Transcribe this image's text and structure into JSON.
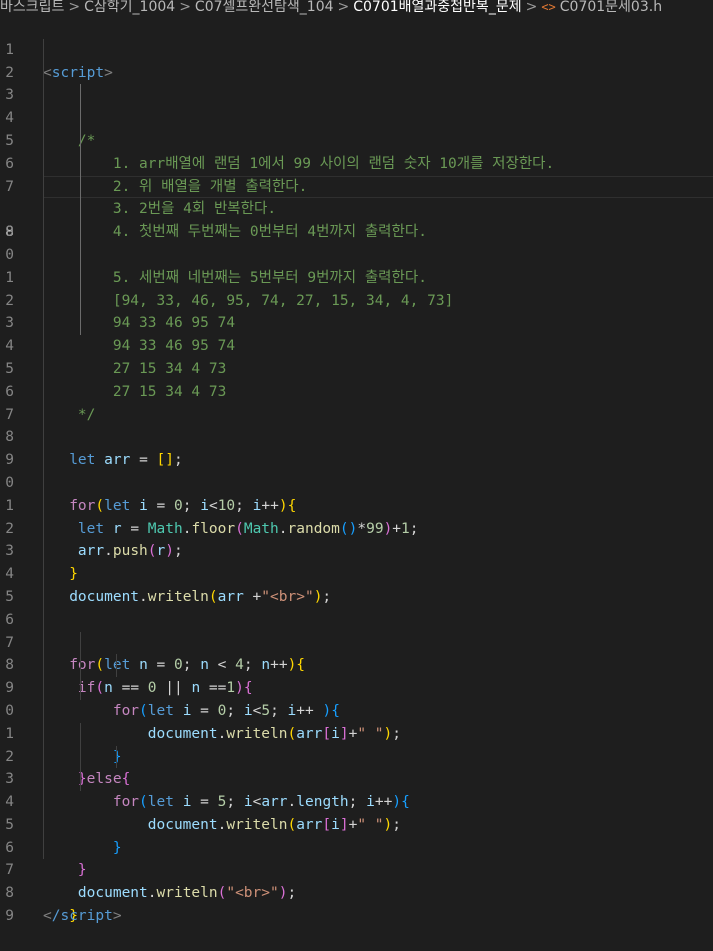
{
  "breadcrumb": {
    "items": [
      "바스크립트",
      "C삼학기_1004",
      "C07셀프완선탐색_104",
      "C0701배열과중첩반복_문제",
      "C0701문세03.h"
    ],
    "file_icon": "<>"
  },
  "editor": {
    "current_line": 8,
    "line_numbers": [
      "1",
      "2",
      "3",
      "4",
      "5",
      "6",
      "7",
      "8",
      "9",
      "0",
      "1",
      "2",
      "3",
      "4",
      "5",
      "6",
      "7",
      "8",
      "9",
      "0",
      "1",
      "2",
      "3",
      "4",
      "5",
      "6",
      "7",
      "8",
      "9",
      "0",
      "1",
      "2",
      "3",
      "4",
      "5",
      "6",
      "7",
      "8",
      "9"
    ],
    "colors": {
      "background": "#1e1e1e",
      "keyword": "#569cd6",
      "control": "#c586c0",
      "variable": "#9cdcfe",
      "function": "#dcdcaa",
      "number": "#b5cea8",
      "string": "#ce9178",
      "comment": "#6a9955",
      "bracket1": "#ffd700",
      "bracket2": "#da70d6",
      "bracket3": "#179fff"
    }
  },
  "code": {
    "script_open": "script",
    "script_close": "/script",
    "comment_open": "/*",
    "comment_close": "*/",
    "comment_lines": [
      "1. arr배열에 랜덤 1에서 99 사이의 랜덤 숫자 10개를 저장한다.",
      "2. 위 배열을 개별 출력한다.",
      "3. 2번을 4회 반복한다.",
      "4. 첫번째 두번째는 0번부터 4번까지 출력한다.",
      "5. 세번째 네번째는 5번부터 9번까지 출력한다."
    ],
    "output_lines": [
      "[94, 33, 46, 95, 74, 27, 15, 34, 4, 73]",
      "94 33 46 95 74",
      "94 33 46 95 74",
      "27 15 34 4 73",
      "27 15 34 4 73"
    ],
    "str_br": "\"<br>\"",
    "str_space": "\" \""
  }
}
